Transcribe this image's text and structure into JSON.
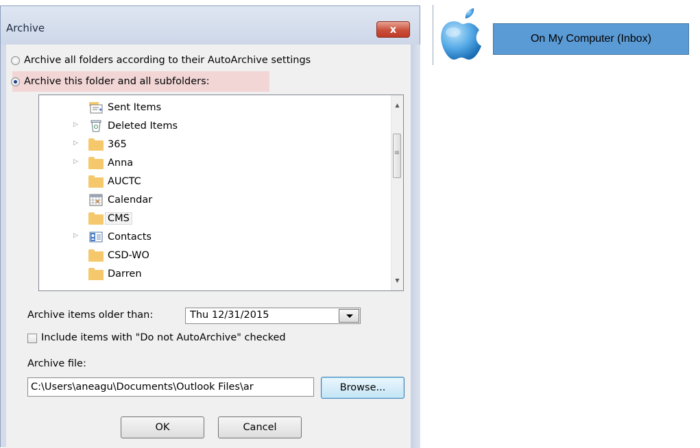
{
  "dialog": {
    "title": "Archive",
    "close_label": "x",
    "radio_all_label": "Archive all folders according to their AutoArchive settings",
    "radio_this_label": "Archive this folder and all subfolders:",
    "folders": [
      {
        "label": "Sent Items",
        "icon": "sent-items-icon",
        "expandable": false,
        "selected": false
      },
      {
        "label": "Deleted Items",
        "icon": "trash-icon",
        "expandable": true,
        "selected": false
      },
      {
        "label": "365",
        "icon": "folder-icon",
        "expandable": true,
        "selected": false
      },
      {
        "label": "Anna",
        "icon": "folder-icon",
        "expandable": true,
        "selected": false
      },
      {
        "label": "AUCTC",
        "icon": "folder-icon",
        "expandable": false,
        "selected": false
      },
      {
        "label": "Calendar",
        "icon": "calendar-icon",
        "expandable": false,
        "selected": false
      },
      {
        "label": "CMS",
        "icon": "folder-icon",
        "expandable": false,
        "selected": true
      },
      {
        "label": "Contacts",
        "icon": "contacts-icon",
        "expandable": true,
        "selected": false
      },
      {
        "label": "CSD-WO",
        "icon": "folder-icon",
        "expandable": false,
        "selected": false
      },
      {
        "label": "Darren",
        "icon": "folder-icon",
        "expandable": false,
        "selected": false
      }
    ],
    "older_than_label": "Archive items older than:",
    "older_than_value": "Thu 12/31/2015",
    "include_label": "Include items with \"Do not AutoArchive\" checked",
    "archive_file_label": "Archive file:",
    "archive_file_value": "C:\\Users\\aneagu\\Documents\\Outlook Files\\ar",
    "browse_label": "Browse...",
    "ok_label": "OK",
    "cancel_label": "Cancel"
  },
  "annotation": {
    "callout_text": "On My Computer (Inbox)",
    "logo_icon": "apple-logo-icon"
  },
  "colors": {
    "callout_fill": "#5b9bd5",
    "highlight": "#f2d6d6",
    "close_button": "#c9503b",
    "folder": "#f5c86c"
  }
}
